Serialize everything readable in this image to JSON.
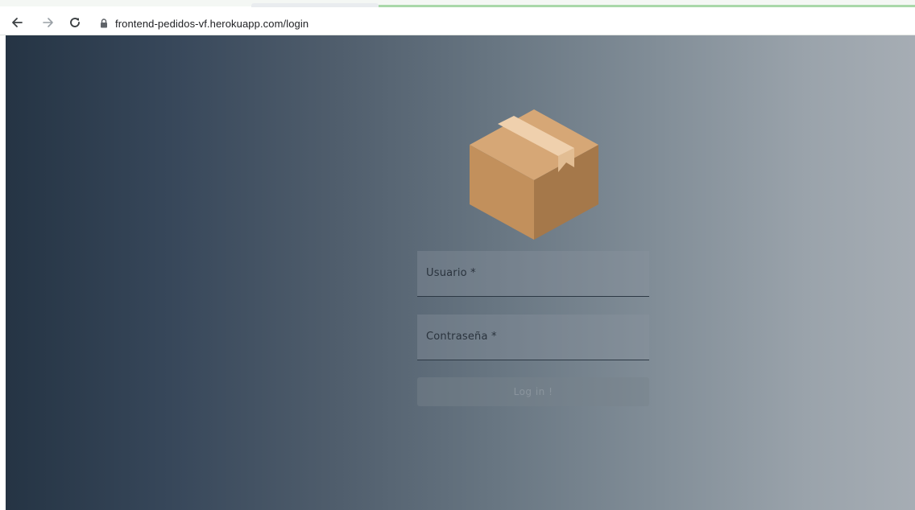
{
  "browser": {
    "back_icon": "arrow-left-icon",
    "forward_icon": "arrow-right-icon",
    "reload_icon": "reload-icon",
    "lock_icon": "lock-icon",
    "url": "frontend-pedidos-vf.herokuapp.com/login"
  },
  "login": {
    "logo_icon": "cardboard-box-icon",
    "username_label": "Usuario *",
    "password_label": "Contraseña *",
    "submit_label": "Log in !"
  },
  "colors": {
    "background_gradient_start": "#253444",
    "background_gradient_end": "#a6adb4",
    "box_top": "#d6a776",
    "box_left": "#c2905c",
    "box_right": "#a5784a",
    "box_tape": "#efd0ad"
  }
}
